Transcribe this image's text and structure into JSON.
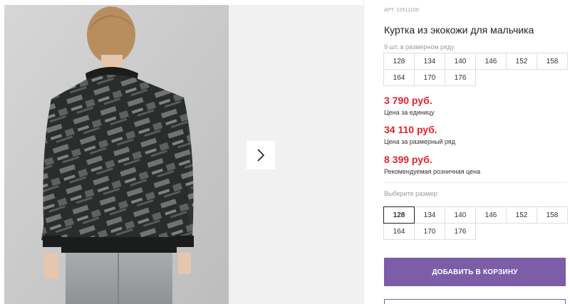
{
  "product": {
    "sku_label": "АРТ.",
    "sku": "12511100",
    "title": "Куртка из экокожи для мальчика",
    "range_note": "9 шт. в размерном ряду",
    "range_sizes": [
      "128",
      "134",
      "140",
      "146",
      "152",
      "158",
      "164",
      "170",
      "176"
    ]
  },
  "prices": [
    {
      "value": "3 790 руб.",
      "label": "Цена за единицу"
    },
    {
      "value": "34 110 руб.",
      "label": "Цена за размерный ряд"
    },
    {
      "value": "8 399 руб.",
      "label": "Рекомендуемая розничная цена"
    }
  ],
  "size_select": {
    "label": "Выберите размер:",
    "sizes": [
      "128",
      "134",
      "140",
      "146",
      "152",
      "158",
      "164",
      "170",
      "176"
    ],
    "selected": "128"
  },
  "actions": {
    "add_to_cart": "ДОБАВИТЬ В КОРЗИНУ"
  },
  "gallery": {
    "next_icon": "chevron-right-icon",
    "photo_subject": "jacket-photo"
  },
  "colors": {
    "accent": "#7b5ea7",
    "price": "#e8202d"
  }
}
